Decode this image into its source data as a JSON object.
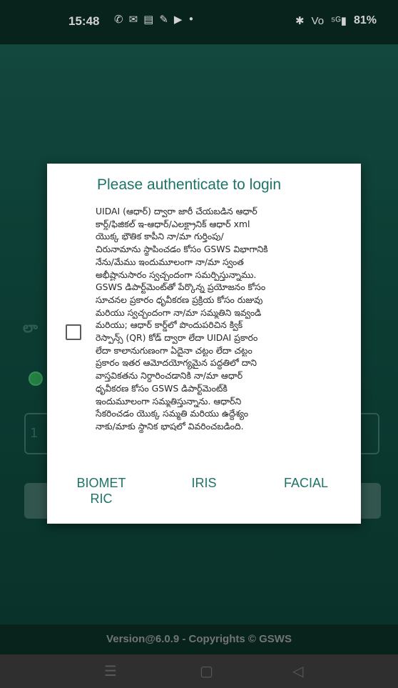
{
  "status_bar": {
    "time": "15:48",
    "left_icons": [
      "✆",
      "✉",
      "▤",
      "✎",
      "▶",
      "•"
    ],
    "right_icons": [
      "✱",
      "Vo",
      "⁵ᴳ▮"
    ],
    "battery": "81%"
  },
  "background": {
    "label_fragment": "లా",
    "input_fragment": "1"
  },
  "dialog": {
    "title": "Please authenticate to login",
    "consent_lines": [
      "UIDAI (ఆధార్) ద్వారా జారీ చేయబడిన ఆధార్",
      "కార్డ్/ఫిజికల్ ఇ-ఆధార్/ఎలక్ట్రానిక్ ఆధార్ xml",
      "యొక్క భౌతిక కాపీని నా/మా గుర్తింపు/",
      "చిరునామాను స్థాపించడం కోసం GSWS విభాగానికి",
      "నేను/మేము ఇందుమూలంగా నా/మా స్వంత",
      "అభీష్టానుసారం స్వచ్ఛందంగా సమర్పిస్తున్నాము.",
      "GSWS డిపార్ట్‌మెంట్‌తో పేర్కొన్న ప్రయోజనం కోసం",
      "సూచనల ప్రకారం ధృవీకరణ ప్రక్రియ కోసం రుజువు",
      "మరియు స్వచ్ఛందంగా నా/మా సమ్మతిని ఇవ్వండి",
      "మరియు; ఆధార్ కార్డ్‌లో పొందుపరిచిన క్విక్",
      "రెస్పాన్స్ (QR) కోడ్ ద్వారా లేదా UIDAI ప్రకారం",
      "లేదా కాలానుగుణంగా ఏదైనా చట్టం లేదా చట్టం",
      "ప్రకారం ఇతర ఆమోదయోగ్యమైన పద్ధతిలో దాని",
      "వాస్తవికతను నిర్ధారించడానికి నా/మా ఆధార్",
      "ధృవీకరణ కోసం GSWS డిపార్ట్‌మెంట్‌కి",
      "ఇందుమూలంగా సమ్మతిస్తున్నాను. ఆధార్‌ని",
      "సేకరించడం యొక్క సమ్మతి మరియు ఉద్దేశ్యం",
      "నాకు/మాకు స్థానిక భాషలో వివరించబడింది."
    ],
    "checkbox_checked": false,
    "buttons": {
      "biometric_line1": "BIOMET",
      "biometric_line2": "RIC",
      "iris": "IRIS",
      "facial": "FACIAL"
    }
  },
  "footer": {
    "version_text": "Version@6.0.9 - Copyrights © GSWS"
  },
  "nav": {
    "recent": "☰",
    "home": "▢",
    "back": "◁"
  },
  "colors": {
    "accent": "#1c7467",
    "app_background": "#17584c"
  }
}
